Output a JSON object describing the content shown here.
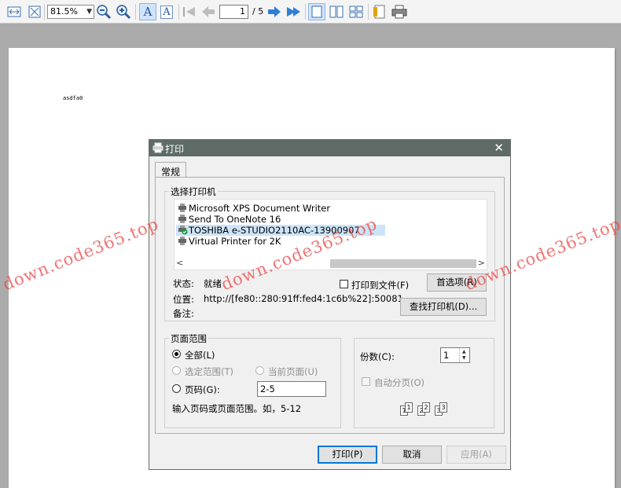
{
  "toolbar": {
    "zoom": "81.5%",
    "page_current": "1",
    "page_total": "/ 5",
    "icons": [
      "fit-width-icon",
      "fit-page-icon",
      "zoom-out-icon",
      "zoom-in-icon",
      "text-select-icon",
      "text-outline-icon",
      "first-page-icon",
      "previous-page-icon",
      "next-page-icon",
      "last-page-icon",
      "single-page-icon",
      "two-page-icon",
      "multi-page-icon",
      "page-setup-icon",
      "print-icon"
    ]
  },
  "document": {
    "text": "asdfa0"
  },
  "watermark": {
    "text": "down.code365.top",
    "color": "#e84646"
  },
  "dialog": {
    "title": "打印",
    "tab": "常规",
    "select_printer": {
      "title": "选择打印机",
      "printers": [
        {
          "name": "Microsoft XPS Document Writer",
          "selected": false
        },
        {
          "name": "Send To OneNote 16",
          "selected": false
        },
        {
          "name": "TOSHIBA e-STUDIO2110AC-13900907",
          "selected": true
        },
        {
          "name": "Virtual Printer for 2K",
          "selected": false
        }
      ],
      "status_label": "状态:",
      "status_value": "就绪",
      "location_label": "位置:",
      "location_value": "http://[fe80::280:91ff:fed4:1c6b%22]:50081",
      "comment_label": "备注:",
      "print_to_file": "打印到文件(F)",
      "preferences_button": "首选项(R)",
      "find_printer_button": "查找打印机(D)..."
    },
    "page_range": {
      "title": "页面范围",
      "all": "全部(L)",
      "selection": "选定范围(T)",
      "current_page": "当前页面(U)",
      "pages": "页码(G):",
      "pages_value": "2-5",
      "hint": "输入页码或页面范围。如，5-12"
    },
    "copies": {
      "label": "份数(C):",
      "value": "1",
      "collate": "自动分页(O)",
      "sheets": [
        "1",
        "1",
        "2",
        "2",
        "3",
        "3"
      ]
    },
    "buttons": {
      "print": "打印(P)",
      "cancel": "取消",
      "apply": "应用(A)"
    },
    "accent": "#0078d7",
    "titlebar_color": "#5f6b66"
  }
}
